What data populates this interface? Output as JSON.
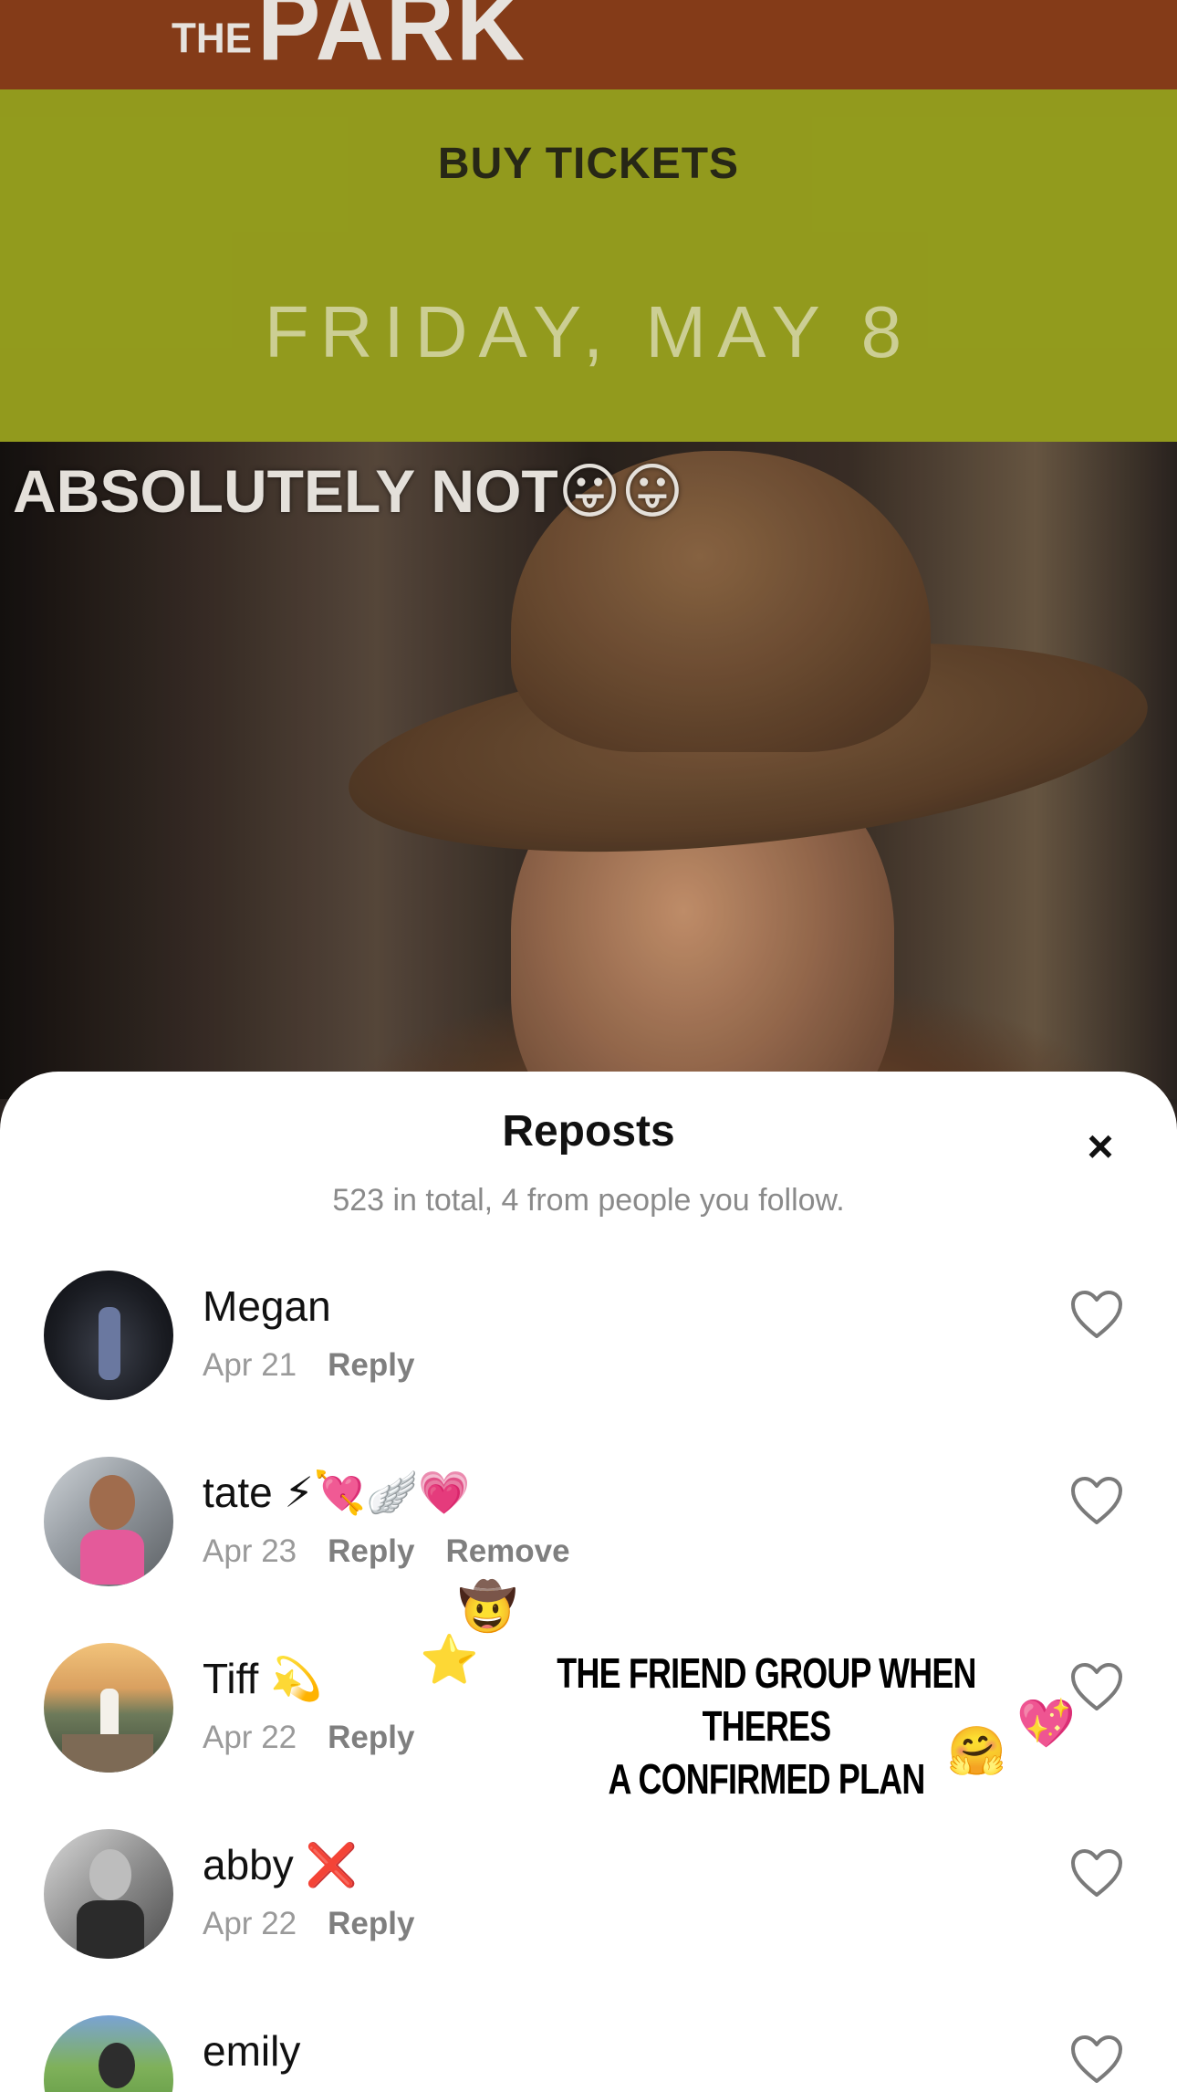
{
  "background_video": {
    "banner_logo_small": "THE",
    "banner_logo_big": "PARK",
    "buy_tickets": "BUY TICKETS",
    "event_date": "FRIDAY, MAY 8",
    "caption_text": "ABSOLUTELY NOT",
    "caption_emoji": "😛😛"
  },
  "sheet": {
    "title": "Reposts",
    "close_label": "×",
    "subtitle": "523 in total, 4 from people you follow."
  },
  "reposts": [
    {
      "name": "Megan",
      "emoji": "",
      "date": "Apr 21",
      "reply": "Reply",
      "remove": ""
    },
    {
      "name": "tate",
      "emoji": "⚡💘🪽💗",
      "date": "Apr 23",
      "reply": "Reply",
      "remove": "Remove"
    },
    {
      "name": "Tiff",
      "emoji": "💫",
      "date": "Apr 22",
      "reply": "Reply",
      "remove": ""
    },
    {
      "name": "abby",
      "emoji": "❌",
      "date": "Apr 22",
      "reply": "Reply",
      "remove": ""
    },
    {
      "name": "emily",
      "emoji": "",
      "date": "",
      "reply": "",
      "remove": ""
    }
  ],
  "overlay": {
    "text_line1": "THE FRIEND GROUP WHEN THERES",
    "text_line2": "A CONFIRMED PLAN",
    "stickers": [
      "🤠",
      "⭐",
      "💖",
      "🤗"
    ]
  },
  "colors": {
    "banner": "#8c3f1a",
    "green_panel": "#9aa31f",
    "sheet_bg": "#ffffff",
    "muted_text": "#9a9a9a"
  }
}
